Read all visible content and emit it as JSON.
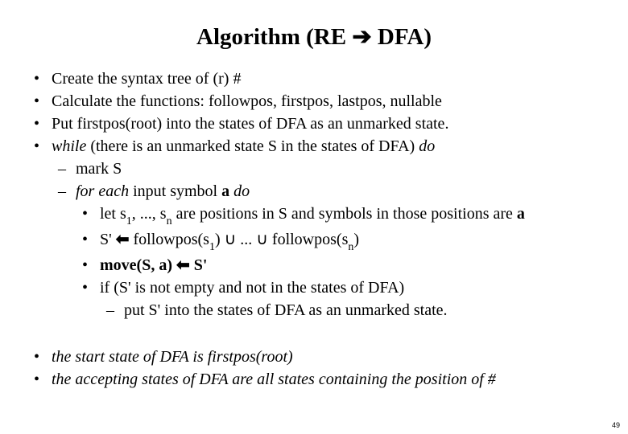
{
  "title_pre": "Algorithm (RE ",
  "title_arrow": "➔",
  "title_post": " DFA)",
  "b1": "Create the syntax tree of  (r) #",
  "b2": "Calculate the functions: followpos, firstpos, lastpos, nullable",
  "b3": "Put firstpos(root) into the states of DFA as an unmarked state.",
  "b4_while": "while",
  "b4_mid": " (there is an unmarked state S in the states of DFA) ",
  "b4_do": "do",
  "s1": "mark S",
  "s2_for": "for each",
  "s2_mid": "  input symbol ",
  "s2_a": "a",
  "s2_do": "  do",
  "t1_pre": "let s",
  "t1_sub1": "1",
  "t1_mid": ", ..., s",
  "t1_subn": "n",
  "t1_post": " are positions in S and symbols in those positions are ",
  "t1_a": "a",
  "t2_pre": "S' ",
  "t2_arrow": "⬅",
  "t2_mid": " followpos(s",
  "t2_s1": "1",
  "t2_cup_pre": ") ",
  "t2_cup": "∪",
  "t2_dots": " ... ",
  "t2_cup2": "∪",
  "t2_end": " followpos(s",
  "t2_sn": "n",
  "t2_close": ")",
  "t3_move": "move(S, a) ",
  "t3_arrow": "⬅",
  "t3_s": " S'",
  "t4": "if  (S' is not empty  and not in the states of DFA)",
  "u1": "put S' into the states of DFA as an unmarked state.",
  "bot1": "the start state of DFA is firstpos(root)",
  "bot2": "the accepting states of DFA are all states containing the position of #",
  "pagenum": "49"
}
